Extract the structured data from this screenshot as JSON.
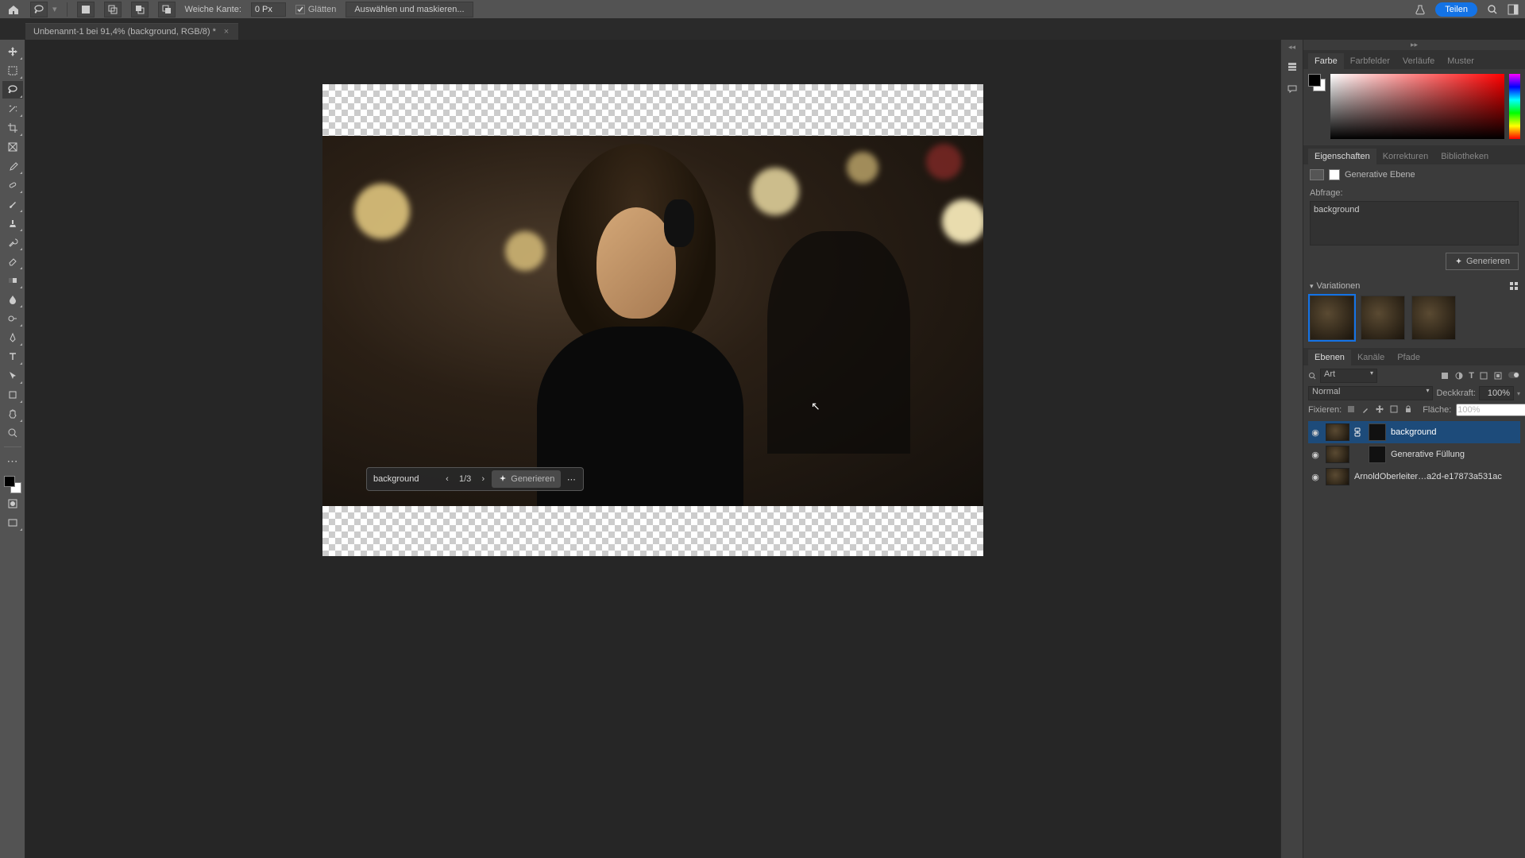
{
  "menubar": {
    "feather_label": "Weiche Kante:",
    "feather_value": "0 Px",
    "antialias_label": "Glätten",
    "select_mask_label": "Auswählen und maskieren...",
    "share_label": "Teilen"
  },
  "tab": {
    "title": "Unbenannt-1 bei 91,4% (background, RGB/8) *"
  },
  "contextbar": {
    "prompt_value": "background",
    "count": "1/3",
    "generate_label": "Generieren"
  },
  "panels": {
    "color_tabs": {
      "farbe": "Farbe",
      "farbfelder": "Farbfelder",
      "verlaeufe": "Verläufe",
      "muster": "Muster"
    },
    "prop_tabs": {
      "eigenschaften": "Eigenschaften",
      "korrekturen": "Korrekturen",
      "bibliotheken": "Bibliotheken"
    },
    "prop_title": "Generative Ebene",
    "prop_prompt_label": "Abfrage:",
    "prop_prompt_value": "background",
    "generate_btn": "Generieren",
    "variations_label": "Variationen",
    "layer_tabs": {
      "ebenen": "Ebenen",
      "kanaele": "Kanäle",
      "pfade": "Pfade"
    },
    "layer_search_mode": "Art",
    "blend_mode": "Normal",
    "opacity_label": "Deckkraft:",
    "opacity_value": "100%",
    "fill_label": "Fläche:",
    "fill_value": "100%",
    "lock_label": "Fixieren:",
    "layers": [
      {
        "name": "background"
      },
      {
        "name": "Generative Füllung"
      },
      {
        "name": "ArnoldOberleiter…a2d-e17873a531ac"
      }
    ]
  }
}
